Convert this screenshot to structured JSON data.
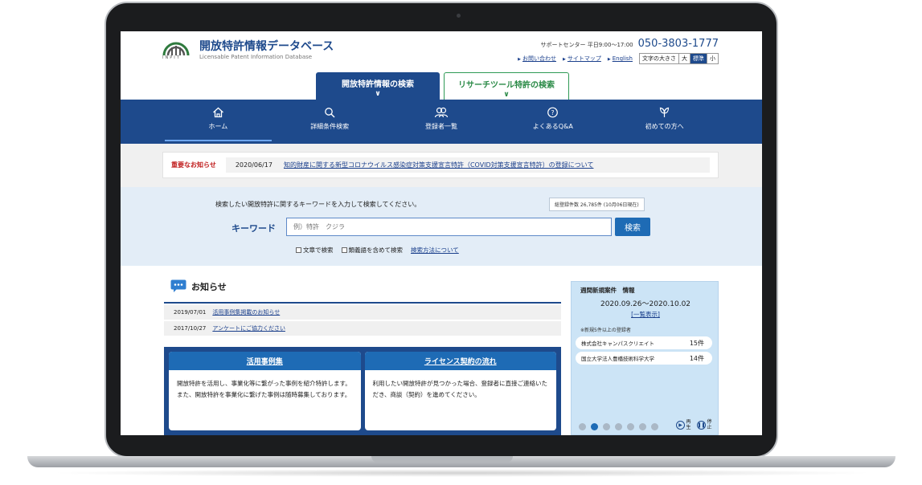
{
  "header": {
    "site_title": "開放特許情報データベース",
    "site_subtitle": "Licensable Patent Information Database",
    "logo_text": "INPIT",
    "support_label": "サポートセンター 平日9:00〜17:00",
    "support_phone": "050-3803-1777",
    "links": [
      "お問い合わせ",
      "サイトマップ",
      "English"
    ],
    "font_size_label": "文字の大きさ",
    "font_sizes": [
      "大",
      "標準",
      "小"
    ],
    "font_size_selected": "標準"
  },
  "search_tabs": [
    {
      "label": "開放特許情報の検索",
      "active": true
    },
    {
      "label": "リサーチツール特許の検索",
      "active": false
    }
  ],
  "nav": [
    {
      "label": "ホーム",
      "icon": "home-icon"
    },
    {
      "label": "詳細条件検索",
      "icon": "search-icon"
    },
    {
      "label": "登録者一覧",
      "icon": "users-icon"
    },
    {
      "label": "よくあるQ&A",
      "icon": "question-icon"
    },
    {
      "label": "初めての方へ",
      "icon": "leaf-icon"
    }
  ],
  "important_notice": {
    "label": "重要なお知らせ",
    "date": "2020/06/17",
    "text": "知的財産に関する新型コロナウイルス感染症対策支援宣言特許（COVID対策支援宣言特許）の登録について"
  },
  "search": {
    "heading": "検索したい開放特許に関するキーワードを入力して検索してください。",
    "count_badge": "総登録件数 26,785件 (10月06日現在)",
    "keyword_label": "キーワード",
    "placeholder": "例）特許　クジラ",
    "button_label": "検索",
    "option_fulltext": "文章で検索",
    "option_synonyms": "類義語を含めて検索",
    "help_link": "検索方法について"
  },
  "news": {
    "title": "お知らせ",
    "items": [
      {
        "date": "2019/07/01",
        "text": "活用事例集掲載のお知らせ"
      },
      {
        "date": "2017/10/27",
        "text": "アンケートにご協力ください"
      }
    ]
  },
  "cards": [
    {
      "title": "活用事例集",
      "body": "開放特許を活用し、事業化等に繋がった事例を紹介特許します。また、開放特許を事業化に繋げた事例は随時募集しております。"
    },
    {
      "title": "ライセンス契約の流れ",
      "body": "利用したい開放特許が見つかった場合、登録者に直接ご連絡いただき、商談（契約）を進めてください。"
    }
  ],
  "weekly": {
    "title": "週間新規案件　情報",
    "range": "2020.09.26〜2020.10.02",
    "list_link": "[一覧表示]",
    "note": "※新規5件以上の登録者",
    "rows": [
      {
        "name": "株式会社キャンパスクリエイト",
        "count": "15件"
      },
      {
        "name": "国立大学法人豊橋技術科学大学",
        "count": "14件"
      }
    ],
    "slide_count": 7,
    "active_slide": 2,
    "play_label": "再生",
    "stop_label": "停止"
  },
  "colors": {
    "primary": "#1e4a8c",
    "accent_blue": "#1e6bb5",
    "research_green": "#2a8a46",
    "notice_red": "#c01e1e"
  }
}
